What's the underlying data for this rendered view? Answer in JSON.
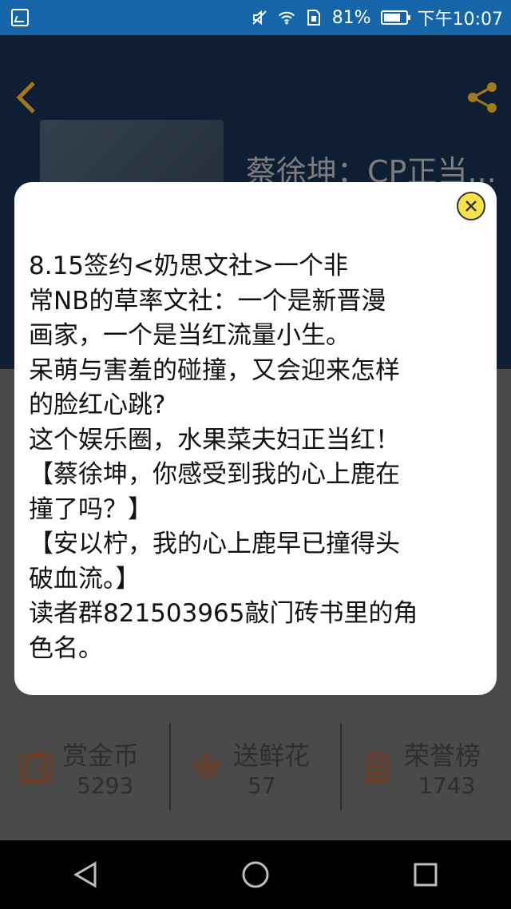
{
  "status_bar": {
    "battery_percent": "81%",
    "time": "下午10:07",
    "battery_level": 0.81
  },
  "header": {
    "book_title": "蔡徐坤：CP正当..."
  },
  "stats": [
    {
      "label": "赏金币",
      "value": "5293",
      "icon": "coin-envelope-icon"
    },
    {
      "label": "送鲜花",
      "value": "57",
      "icon": "flower-icon"
    },
    {
      "label": "荣誉榜",
      "value": "1743",
      "icon": "medal-icon"
    }
  ],
  "modal": {
    "text": "8.15签约<奶思文社>一个非\n常NB的草率文社：一个是新晋漫\n画家，一个是当红流量小生。\n呆萌与害羞的碰撞，又会迎来怎样\n的脸红心跳?\n这个娱乐圈，水果菜夫妇正当红！\n【蔡徐坤，你感受到我的心上鹿在\n撞了吗？】\n【安以柠，我的心上鹿早已撞得头\n破血流。】\n读者群821503965敲门砖书里的角\n色名。"
  },
  "colors": {
    "status_bar": "#1565a8",
    "accent": "#a27a1c",
    "close_button": "#f7e24a"
  }
}
